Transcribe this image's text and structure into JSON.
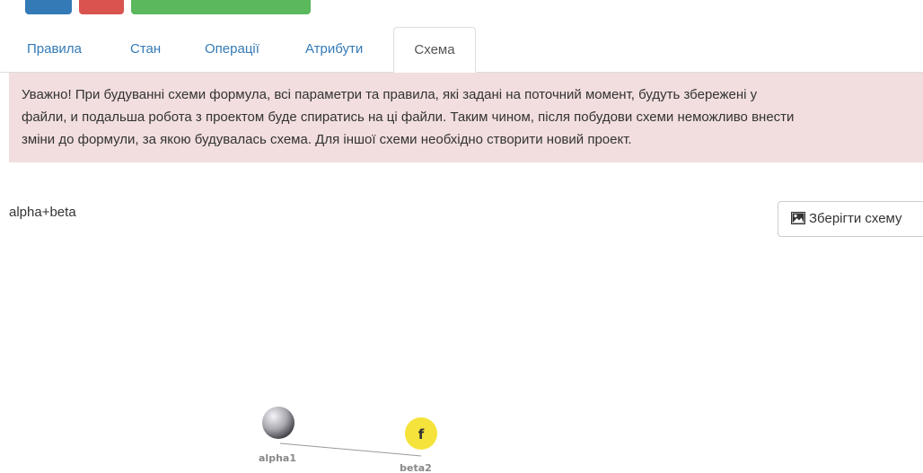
{
  "tabs": [
    {
      "label": "Правила"
    },
    {
      "label": "Стан"
    },
    {
      "label": "Операції"
    },
    {
      "label": "Атрибути"
    },
    {
      "label": "Схема",
      "active": true
    }
  ],
  "alert": {
    "line1": "Уважно! При будуванні схеми формула, всі параметри та правила, які задані на поточний момент, будуть збережені у",
    "line2": "файли, и подальша робота з проектом буде спиратись на ці файли. Таким чином, після побудови схеми неможливо внести",
    "line3": "зміни до формули, за якою будувалась схема. Для іншої схеми необхідно створити новий проект."
  },
  "formula": "alpha+beta",
  "save_button": {
    "label": "Зберігти схему",
    "icon": "image-icon"
  },
  "graph": {
    "nodes": [
      {
        "id": "alpha1",
        "label": "alpha1",
        "kind": "sphere"
      },
      {
        "id": "beta2",
        "label": "beta2",
        "kind": "function",
        "glyph": "f"
      }
    ],
    "edges": [
      {
        "from": "alpha1",
        "to": "beta2"
      }
    ]
  },
  "colors": {
    "link": "#337ab7",
    "alert_bg": "#f2dede",
    "function_node": "#f5e33b"
  }
}
